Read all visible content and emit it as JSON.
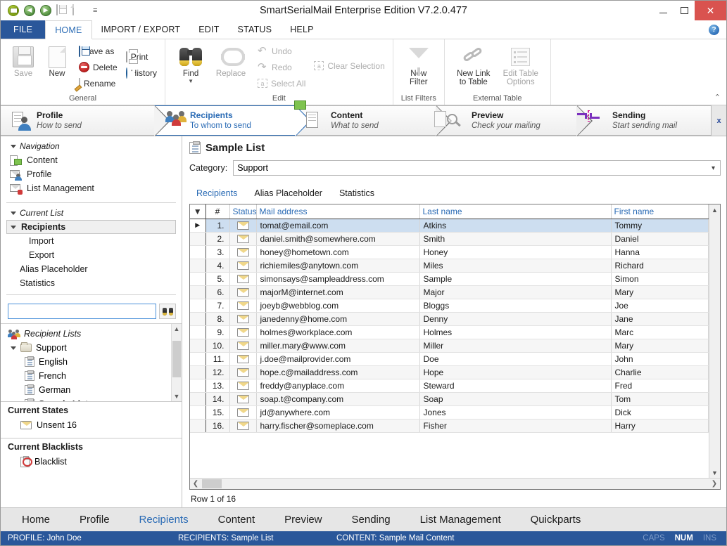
{
  "window": {
    "title": "SmartSerialMail Enterprise Edition V7.2.0.477",
    "minimize": "–",
    "maximize": "☐",
    "close": "✕"
  },
  "quick_access": {
    "items": [
      "mail-icon",
      "back-icon",
      "forward-icon",
      "save-icon",
      "new-icon"
    ],
    "more": "═"
  },
  "ribbon_tabs": {
    "file": "FILE",
    "tabs": [
      "HOME",
      "IMPORT / EXPORT",
      "EDIT",
      "STATUS",
      "HELP"
    ],
    "active": "HOME",
    "help_label": "?"
  },
  "ribbon": {
    "collapse": "⌃",
    "groups": [
      {
        "title": "General",
        "big": [
          {
            "label": "Save",
            "icon": "floppy-disk-icon",
            "disabled": true
          },
          {
            "label": "New",
            "icon": "new-page-icon",
            "disabled": false
          }
        ],
        "small_col_1": [
          {
            "label": "Save as",
            "icon": "save-as-icon"
          },
          {
            "label": "Delete",
            "icon": "delete-icon"
          },
          {
            "label": "Rename",
            "icon": "rename-icon"
          }
        ],
        "small_col_2": [
          {
            "label": "Print",
            "icon": "print-icon"
          },
          {
            "label": "History",
            "icon": "history-icon"
          }
        ]
      },
      {
        "title": "Edit",
        "big": [
          {
            "label": "Find",
            "icon": "binoculars-icon",
            "disabled": false
          },
          {
            "label": "Replace",
            "icon": "replace-icon",
            "disabled": true
          }
        ],
        "small_col_1": [
          {
            "label": "Undo",
            "icon": "undo-icon"
          },
          {
            "label": "Redo",
            "icon": "redo-icon"
          },
          {
            "label": "Select All",
            "icon": "select-all-icon"
          }
        ],
        "small_col_2": [
          {
            "label": "Clear Selection",
            "icon": "clear-selection-icon"
          }
        ]
      },
      {
        "title": "List Filters",
        "big": [
          {
            "label": "New\nFilter",
            "label_1": "New",
            "label_2": "Filter",
            "icon": "funnel-icon"
          }
        ]
      },
      {
        "title": "External Table",
        "big": [
          {
            "label_1": "New Link",
            "label_2": "to Table",
            "icon": "chain-link-icon"
          },
          {
            "label_1": "Edit Table",
            "label_2": "Options",
            "icon": "table-options-icon",
            "disabled": true
          }
        ]
      }
    ]
  },
  "steps": {
    "close_label": "x",
    "items": [
      {
        "title": "Profile",
        "sub": "How to send",
        "icon": "profile-icon",
        "active": false
      },
      {
        "title": "Recipients",
        "sub": "To whom to send",
        "icon": "recipients-icon",
        "active": true
      },
      {
        "title": "Content",
        "sub": "What to send",
        "icon": "content-icon",
        "active": false
      },
      {
        "title": "Preview",
        "sub": "Check your mailing",
        "icon": "preview-icon",
        "active": false
      },
      {
        "title": "Sending",
        "sub": "Start sending mail",
        "icon": "sending-icon",
        "active": false
      }
    ]
  },
  "sidebar": {
    "navigation": {
      "header": "Navigation",
      "items": [
        {
          "label": "Content",
          "icon": "content-icon"
        },
        {
          "label": "Profile",
          "icon": "profile-icon"
        },
        {
          "label": "List Management",
          "icon": "list-management-icon"
        }
      ]
    },
    "current_list": {
      "header": "Current List",
      "selected": "Recipients",
      "children": [
        "Import",
        "Export"
      ],
      "siblings": [
        "Alias Placeholder",
        "Statistics"
      ]
    },
    "search": {
      "value": "",
      "placeholder": "",
      "button_icon": "binoculars-icon"
    },
    "recipient_lists": {
      "header": "Recipient Lists",
      "items": [
        {
          "label": "Support",
          "icon": "folder-icon",
          "level": 0,
          "expanded": true
        },
        {
          "label": "English",
          "icon": "list-icon",
          "level": 1
        },
        {
          "label": "French",
          "icon": "list-icon",
          "level": 1
        },
        {
          "label": "German",
          "icon": "list-icon",
          "level": 1
        },
        {
          "label": "Sample List",
          "icon": "list-icon",
          "level": 1
        }
      ]
    },
    "current_states": {
      "header": "Current States",
      "items": [
        {
          "label": "Unsent 16",
          "icon": "envelope-icon"
        }
      ]
    },
    "current_blacklists": {
      "header": "Current Blacklists",
      "items": [
        {
          "label": "Blacklist",
          "icon": "blacklist-icon"
        }
      ]
    }
  },
  "main": {
    "title": "Sample List",
    "title_icon": "list-icon",
    "category_label": "Category:",
    "category_value": "Support",
    "category_options": [
      "Support"
    ],
    "tabs": [
      {
        "label": "Recipients",
        "selected": true
      },
      {
        "label": "Alias Placeholder",
        "selected": false
      },
      {
        "label": "Statistics",
        "selected": false
      }
    ],
    "grid": {
      "columns": [
        "",
        "#",
        "Status",
        "Mail address",
        "Last name",
        "First name"
      ],
      "rows": [
        {
          "n": "1.",
          "status": "unsent-envelope-icon",
          "mail": "tomat@email.com",
          "last": "Atkins",
          "first": "Tommy"
        },
        {
          "n": "2.",
          "status": "unsent-envelope-icon",
          "mail": "daniel.smith@somewhere.com",
          "last": "Smith",
          "first": "Daniel"
        },
        {
          "n": "3.",
          "status": "unsent-envelope-icon",
          "mail": "honey@hometown.com",
          "last": "Honey",
          "first": "Hanna"
        },
        {
          "n": "4.",
          "status": "unsent-envelope-icon",
          "mail": "richiemiles@anytown.com",
          "last": "Miles",
          "first": "Richard"
        },
        {
          "n": "5.",
          "status": "unsent-envelope-icon",
          "mail": "simonsays@sampleaddress.com",
          "last": "Sample",
          "first": "Simon"
        },
        {
          "n": "6.",
          "status": "unsent-envelope-icon",
          "mail": "majorM@internet.com",
          "last": "Major",
          "first": "Mary"
        },
        {
          "n": "7.",
          "status": "unsent-envelope-icon",
          "mail": "joeyb@webblog.com",
          "last": "Bloggs",
          "first": "Joe"
        },
        {
          "n": "8.",
          "status": "unsent-envelope-icon",
          "mail": "janedenny@home.com",
          "last": "Denny",
          "first": "Jane"
        },
        {
          "n": "9.",
          "status": "unsent-envelope-icon",
          "mail": "holmes@workplace.com",
          "last": "Holmes",
          "first": "Marc"
        },
        {
          "n": "10.",
          "status": "unsent-envelope-icon",
          "mail": "miller.mary@www.com",
          "last": "Miller",
          "first": "Mary"
        },
        {
          "n": "11.",
          "status": "unsent-envelope-icon",
          "mail": "j.doe@mailprovider.com",
          "last": "Doe",
          "first": "John"
        },
        {
          "n": "12.",
          "status": "unsent-envelope-icon",
          "mail": "hope.c@mailaddress.com",
          "last": "Hope",
          "first": "Charlie"
        },
        {
          "n": "13.",
          "status": "unsent-envelope-icon",
          "mail": "freddy@anyplace.com",
          "last": "Steward",
          "first": "Fred"
        },
        {
          "n": "14.",
          "status": "unsent-envelope-icon",
          "mail": "soap.t@company.com",
          "last": "Soap",
          "first": "Tom"
        },
        {
          "n": "15.",
          "status": "unsent-envelope-icon",
          "mail": "jd@anywhere.com",
          "last": "Jones",
          "first": "Dick"
        },
        {
          "n": "16.",
          "status": "unsent-envelope-icon",
          "mail": "harry.fischer@someplace.com",
          "last": "Fisher",
          "first": "Harry"
        }
      ],
      "selected_row_index": 0
    },
    "row_info": "Row 1 of 16"
  },
  "bottom_nav": {
    "items": [
      {
        "label": "Home",
        "selected": false
      },
      {
        "label": "Profile",
        "selected": false
      },
      {
        "label": "Recipients",
        "selected": true
      },
      {
        "label": "Content",
        "selected": false
      },
      {
        "label": "Preview",
        "selected": false
      },
      {
        "label": "Sending",
        "selected": false
      },
      {
        "label": "List Management",
        "selected": false
      },
      {
        "label": "Quickparts",
        "selected": false
      }
    ]
  },
  "status_bar": {
    "profile": "PROFILE: John Doe",
    "recipients": "RECIPIENTS: Sample List",
    "content": "CONTENT: Sample Mail Content",
    "caps": "CAPS",
    "num": "NUM",
    "ins": "INS"
  },
  "colors": {
    "accent_blue": "#2a6bb5",
    "status_bar": "#2a579a",
    "file_tab": "#2a579a",
    "close_red": "#d9534f",
    "selection": "#cddef0"
  }
}
